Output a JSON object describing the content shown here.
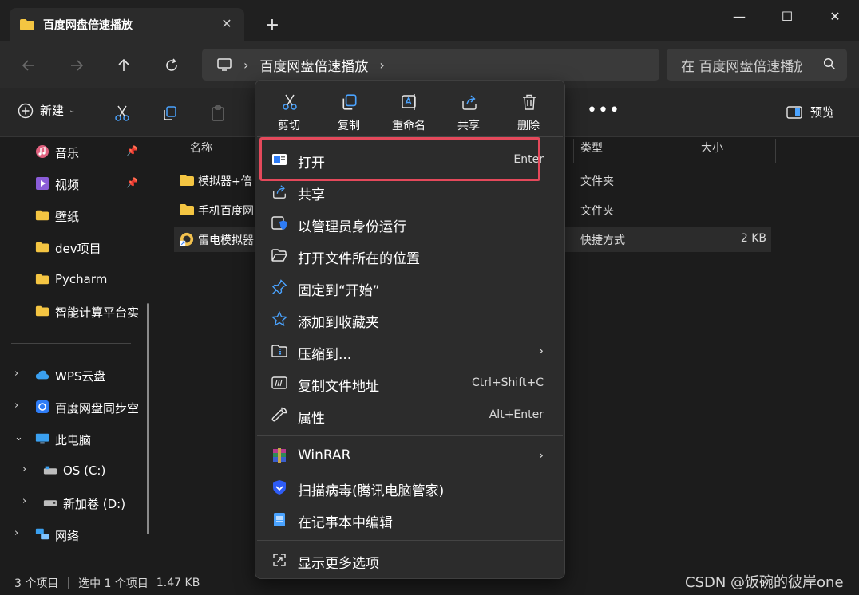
{
  "window": {
    "tab_title": "百度网盘倍速播放",
    "tab_close": "✕",
    "new_tab": "+",
    "minimize": "—",
    "maximize": "☐",
    "close": "✕"
  },
  "nav": {
    "breadcrumb": [
      "百度网盘倍速播放"
    ],
    "search_placeholder": "在 百度网盘倍速播放 中搜索"
  },
  "commandbar": {
    "new_label": "新建",
    "more": "•••",
    "preview_label": "预览"
  },
  "sidebar": {
    "items": [
      {
        "label": "音乐",
        "pinned": true,
        "icon": "music-icon"
      },
      {
        "label": "视频",
        "pinned": true,
        "icon": "video-icon"
      },
      {
        "label": "壁纸",
        "icon": "folder-icon"
      },
      {
        "label": "dev项目",
        "icon": "folder-icon"
      },
      {
        "label": "Pycharm",
        "icon": "folder-icon"
      },
      {
        "label": "智能计算平台实",
        "icon": "folder-icon"
      },
      {
        "label": "WPS云盘",
        "icon": "cloud-icon"
      },
      {
        "label": "百度网盘同步空",
        "icon": "baidu-sync-icon"
      },
      {
        "label": "此电脑",
        "icon": "pc-icon"
      },
      {
        "label": "OS (C:)",
        "icon": "drive-icon"
      },
      {
        "label": "新加卷 (D:)",
        "icon": "drive-icon"
      },
      {
        "label": "网络",
        "icon": "network-icon"
      }
    ]
  },
  "filelist": {
    "columns": {
      "name": "名称",
      "type": "类型",
      "size": "大小"
    },
    "rows": [
      {
        "name": "模拟器+倍",
        "type": "文件夹",
        "size": ""
      },
      {
        "name": "手机百度网",
        "type": "文件夹",
        "size": ""
      },
      {
        "name": "雷电模拟器",
        "type": "快捷方式",
        "size": "2 KB"
      }
    ]
  },
  "status": {
    "count": "3 个项目",
    "selected": "选中 1 个项目",
    "selected_size": "1.47 KB"
  },
  "watermark": "CSDN @饭碗的彼岸one",
  "context_menu": {
    "quick_actions": [
      {
        "label": "剪切",
        "icon": "scissors-icon"
      },
      {
        "label": "复制",
        "icon": "copy-icon"
      },
      {
        "label": "重命名",
        "icon": "rename-icon"
      },
      {
        "label": "共享",
        "icon": "share-icon"
      },
      {
        "label": "删除",
        "icon": "trash-icon"
      }
    ],
    "items": [
      {
        "label": "打开",
        "shortcut": "Enter",
        "icon": "open-window-icon"
      },
      {
        "label": "共享",
        "icon": "share-icon"
      },
      {
        "label": "以管理员身份运行",
        "icon": "admin-shield-icon"
      },
      {
        "label": "打开文件所在的位置",
        "icon": "folder-open-icon"
      },
      {
        "label": "固定到“开始”",
        "icon": "pin-icon"
      },
      {
        "label": "添加到收藏夹",
        "icon": "star-icon"
      },
      {
        "label": "压缩到...",
        "submenu": "›",
        "icon": "zip-folder-icon"
      },
      {
        "label": "复制文件地址",
        "shortcut": "Ctrl+Shift+C",
        "icon": "copy-path-icon"
      },
      {
        "label": "属性",
        "shortcut": "Alt+Enter",
        "icon": "wrench-icon"
      },
      {
        "label": "WinRAR",
        "submenu": "›",
        "icon": "winrar-icon"
      },
      {
        "label": "扫描病毒(腾讯电脑管家)",
        "icon": "tencent-shield-icon"
      },
      {
        "label": "在记事本中编辑",
        "icon": "notepad-icon"
      },
      {
        "label": "显示更多选项",
        "icon": "more-options-icon"
      }
    ]
  },
  "colors": {
    "highlight_border": "#e5495b",
    "folder": "#f4c542",
    "accent": "#4aa3ff"
  }
}
